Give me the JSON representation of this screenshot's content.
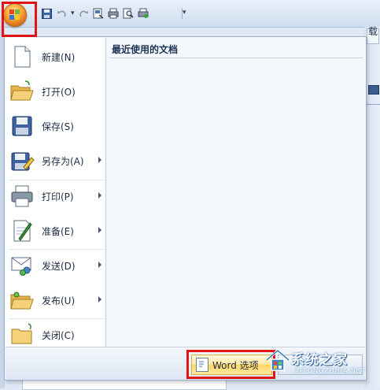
{
  "window": {
    "title_fragment": "载"
  },
  "menu": {
    "items": [
      {
        "label": "新建(N)",
        "icon": "new-document-icon",
        "has_submenu": false
      },
      {
        "label": "打开(O)",
        "icon": "open-folder-icon",
        "has_submenu": false
      },
      {
        "label": "保存(S)",
        "icon": "save-floppy-icon",
        "has_submenu": false
      },
      {
        "label": "另存为(A)",
        "icon": "save-as-icon",
        "has_submenu": true
      },
      {
        "label": "打印(P)",
        "icon": "printer-icon",
        "has_submenu": true
      },
      {
        "label": "准备(E)",
        "icon": "prepare-document-icon",
        "has_submenu": true
      },
      {
        "label": "发送(D)",
        "icon": "send-icon",
        "has_submenu": true
      },
      {
        "label": "发布(U)",
        "icon": "publish-folder-icon",
        "has_submenu": true
      },
      {
        "label": "关闭(C)",
        "icon": "close-folder-icon",
        "has_submenu": false
      }
    ],
    "recent_title": "最近使用的文档",
    "options_button": "Word 选项"
  },
  "watermark": {
    "title": "系统之家",
    "subtitle": "XITONGZHIJIA.NET"
  },
  "colors": {
    "highlight_border": "#e01616",
    "office_button": "#f7a52d",
    "menu_background": "#f4f7fb"
  }
}
